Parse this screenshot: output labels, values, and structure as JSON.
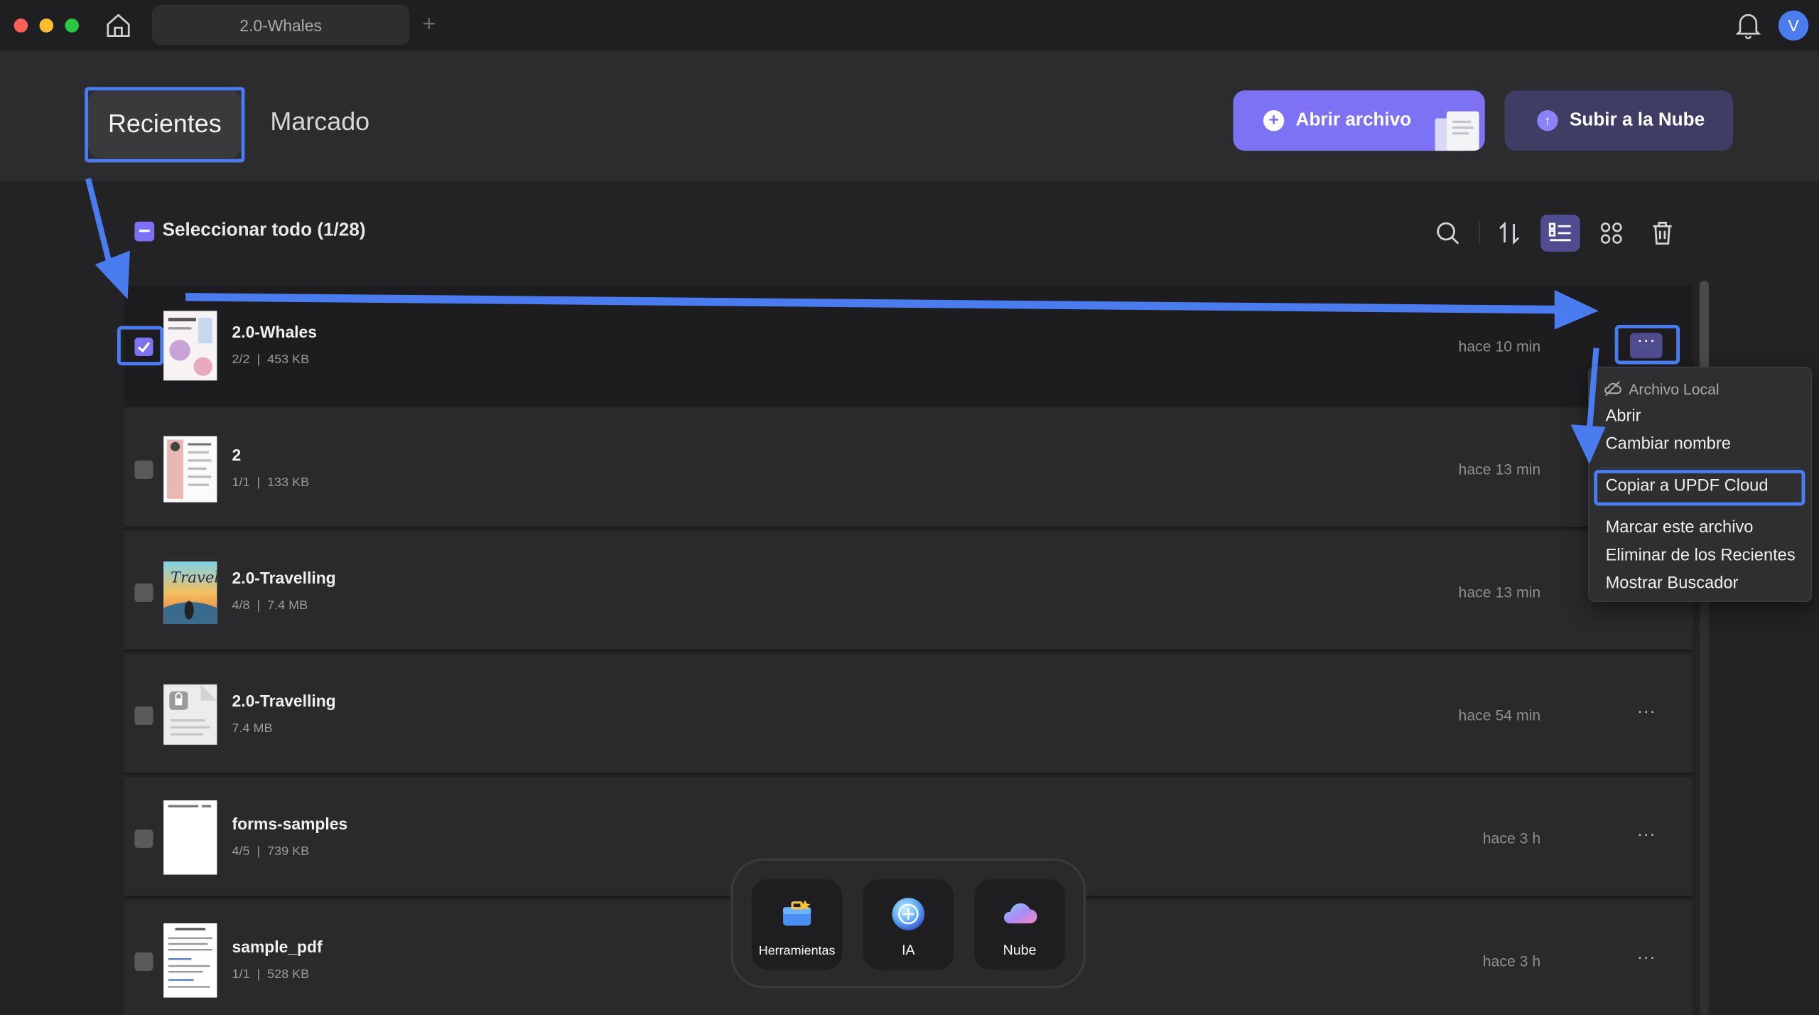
{
  "window": {
    "tab_title": "2.0-Whales",
    "avatar_letter": "V"
  },
  "header": {
    "tab_recent": "Recientes",
    "tab_marked": "Marcado",
    "open_file": "Abrir archivo",
    "upload_cloud": "Subir a la Nube"
  },
  "toolbar": {
    "select_all": "Seleccionar todo (1/28)"
  },
  "files": [
    {
      "name": "2.0-Whales",
      "pages": "2/2",
      "size": "453 KB",
      "time": "hace 10 min",
      "checked": true
    },
    {
      "name": "2",
      "pages": "1/1",
      "size": "133 KB",
      "time": "hace 13 min",
      "checked": false
    },
    {
      "name": "2.0-Travelling",
      "pages": "4/8",
      "size": "7.4 MB",
      "time": "hace 13 min",
      "checked": false
    },
    {
      "name": "2.0-Travelling",
      "pages": "",
      "size": "7.4 MB",
      "time": "hace 54 min",
      "checked": false
    },
    {
      "name": "forms-samples",
      "pages": "4/5",
      "size": "739 KB",
      "time": "hace 3 h",
      "checked": false
    },
    {
      "name": "sample_pdf",
      "pages": "1/1",
      "size": "528 KB",
      "time": "hace 3 h",
      "checked": false
    }
  ],
  "context_menu": {
    "header": "Archivo Local",
    "items": [
      "Abrir",
      "Cambiar nombre",
      "Copiar a UPDF Cloud",
      "Marcar este archivo",
      "Eliminar de los Recientes",
      "Mostrar Buscador"
    ]
  },
  "dock": {
    "tools": "Herramientas",
    "ai": "IA",
    "cloud": "Nube"
  },
  "colors": {
    "accent": "#7c72f3",
    "annotation": "#4a7cf0",
    "background": "#232325"
  }
}
